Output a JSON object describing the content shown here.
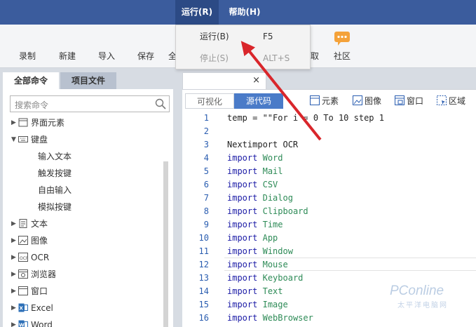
{
  "menubar": {
    "menus": [
      "运行(R)",
      "帮助(H)"
    ]
  },
  "toolbar": {
    "items": [
      "录制",
      "新建",
      "导入",
      "保存",
      "全",
      "取",
      "社区"
    ]
  },
  "dropdown": {
    "items": [
      {
        "label": "运行(B)",
        "shortcut": "F5",
        "enabled": true
      },
      {
        "label": "停止(S)",
        "shortcut": "ALT+S",
        "enabled": false
      }
    ]
  },
  "left_panel": {
    "tabs": [
      "全部命令",
      "项目文件"
    ],
    "search_placeholder": "搜索命令",
    "tree": [
      {
        "label": "界面元素",
        "icon": "ui-element-icon",
        "expanded": false
      },
      {
        "label": "键盘",
        "icon": "keyboard-icon",
        "expanded": true,
        "children": [
          "输入文本",
          "触发按键",
          "自由输入",
          "模拟按键"
        ]
      },
      {
        "label": "文本",
        "icon": "text-doc-icon",
        "expanded": false
      },
      {
        "label": "图像",
        "icon": "image-icon",
        "expanded": false
      },
      {
        "label": "OCR",
        "icon": "ocr-icon",
        "expanded": false
      },
      {
        "label": "浏览器",
        "icon": "browser-icon",
        "expanded": false
      },
      {
        "label": "窗口",
        "icon": "window-icon",
        "expanded": false
      },
      {
        "label": "Excel",
        "icon": "excel-icon",
        "expanded": false
      },
      {
        "label": "Word",
        "icon": "word-icon",
        "expanded": false
      }
    ]
  },
  "editor": {
    "tab_close": "×",
    "view_tabs": [
      "可视化",
      "源代码"
    ],
    "toolbar": [
      "元素",
      "图像",
      "窗口",
      "区域"
    ],
    "lines": [
      {
        "n": "1",
        "text": "temp = \"\"For i = 0 To 10 step 1"
      },
      {
        "n": "2",
        "text": ""
      },
      {
        "n": "3",
        "text": "Nextimport OCR"
      },
      {
        "n": "4",
        "kw": "import",
        "mod": "Word"
      },
      {
        "n": "5",
        "kw": "import",
        "mod": "Mail"
      },
      {
        "n": "6",
        "kw": "import",
        "mod": "CSV"
      },
      {
        "n": "7",
        "kw": "import",
        "mod": "Dialog"
      },
      {
        "n": "8",
        "kw": "import",
        "mod": "Clipboard"
      },
      {
        "n": "9",
        "kw": "import",
        "mod": "Time"
      },
      {
        "n": "10",
        "kw": "import",
        "mod": "App"
      },
      {
        "n": "11",
        "kw": "import",
        "mod": "Window"
      },
      {
        "n": "12",
        "kw": "import",
        "mod": "Mouse"
      },
      {
        "n": "13",
        "kw": "import",
        "mod": "Keyboard"
      },
      {
        "n": "14",
        "kw": "import",
        "mod": "Text"
      },
      {
        "n": "15",
        "kw": "import",
        "mod": "Image"
      },
      {
        "n": "16",
        "kw": "import",
        "mod": "WebBrowser"
      }
    ],
    "current_line": "12"
  },
  "watermark": {
    "text": "PConline",
    "sub": "太平洋电脑网"
  },
  "colors": {
    "menubar": "#3b5c9d",
    "accent": "#4a7bc8",
    "annotation": "#d9262b"
  }
}
